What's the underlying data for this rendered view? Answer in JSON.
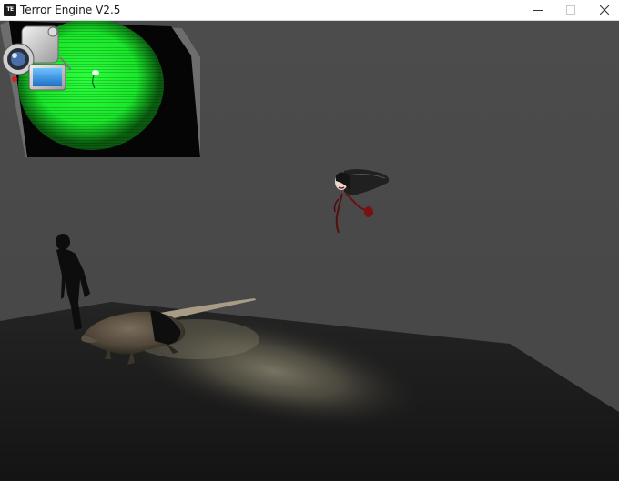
{
  "window": {
    "title": "Terror Engine V2.5",
    "icon_text": "TE",
    "icon": "app-logo-icon",
    "controls": {
      "minimize_icon": "minimize-icon",
      "maximize_icon": "maximize-icon",
      "close_icon": "close-icon"
    }
  },
  "scene": {
    "background_color": "#4b4b4b",
    "floor_color": "#1e1e1e",
    "flashlight_color": "#7a7562",
    "night_vision_color": "#1aff2c"
  },
  "hud": {
    "camera_icon": "camcorder-icon"
  }
}
